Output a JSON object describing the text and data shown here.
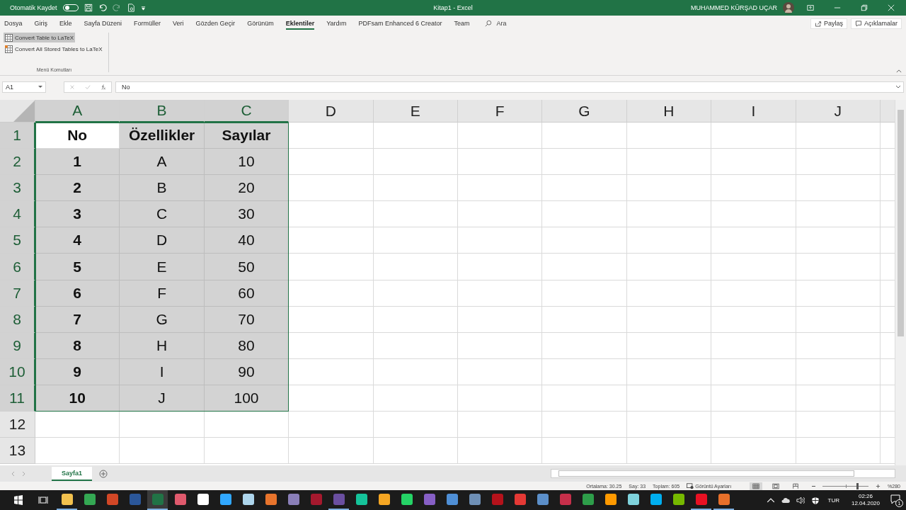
{
  "title_bar": {
    "autosave_label": "Otomatik Kaydet",
    "autosave_on": false,
    "title": "Kitap1 - Excel",
    "user": "MUHAMMED KÜRŞAD UÇAR"
  },
  "tabs": [
    {
      "label": "Dosya",
      "selected": false
    },
    {
      "label": "Giriş",
      "selected": false
    },
    {
      "label": "Ekle",
      "selected": false
    },
    {
      "label": "Sayfa Düzeni",
      "selected": false
    },
    {
      "label": "Formüller",
      "selected": false
    },
    {
      "label": "Veri",
      "selected": false
    },
    {
      "label": "Gözden Geçir",
      "selected": false
    },
    {
      "label": "Görünüm",
      "selected": false
    },
    {
      "label": "Eklentiler",
      "selected": true
    },
    {
      "label": "Yardım",
      "selected": false
    },
    {
      "label": "PDFsam Enhanced 6 Creator",
      "selected": false
    },
    {
      "label": "Team",
      "selected": false
    }
  ],
  "search": {
    "placeholder": "Ara"
  },
  "share_button": "Paylaş",
  "comments_button": "Açıklamalar",
  "ribbon": {
    "group_label": "Menü Komutları",
    "commands": [
      {
        "label": "Convert Table to LaTeX",
        "selected": true
      },
      {
        "label": "Convert All Stored Tables to LaTeX",
        "selected": false
      }
    ]
  },
  "formula_bar": {
    "name_box": "A1",
    "formula": "No"
  },
  "columns": [
    {
      "label": "A",
      "selected": true
    },
    {
      "label": "B",
      "selected": true
    },
    {
      "label": "C",
      "selected": true
    },
    {
      "label": "D",
      "selected": false
    },
    {
      "label": "E",
      "selected": false
    },
    {
      "label": "F",
      "selected": false
    },
    {
      "label": "G",
      "selected": false
    },
    {
      "label": "H",
      "selected": false
    },
    {
      "label": "I",
      "selected": false
    },
    {
      "label": "J",
      "selected": false
    }
  ],
  "rows": [
    {
      "label": "1",
      "selected": true,
      "cells": [
        {
          "text": "No",
          "bold": true,
          "selected": false
        },
        {
          "text": "Özellikler",
          "bold": true,
          "selected": true
        },
        {
          "text": "Sayılar",
          "bold": true,
          "selected": true
        }
      ]
    },
    {
      "label": "2",
      "selected": true,
      "cells": [
        {
          "text": "1",
          "bold": true,
          "selected": true
        },
        {
          "text": "A",
          "bold": false,
          "selected": true
        },
        {
          "text": "10",
          "bold": false,
          "selected": true
        }
      ]
    },
    {
      "label": "3",
      "selected": true,
      "cells": [
        {
          "text": "2",
          "bold": true,
          "selected": true
        },
        {
          "text": "B",
          "bold": false,
          "selected": true
        },
        {
          "text": "20",
          "bold": false,
          "selected": true
        }
      ]
    },
    {
      "label": "4",
      "selected": true,
      "cells": [
        {
          "text": "3",
          "bold": true,
          "selected": true
        },
        {
          "text": "C",
          "bold": false,
          "selected": true
        },
        {
          "text": "30",
          "bold": false,
          "selected": true
        }
      ]
    },
    {
      "label": "5",
      "selected": true,
      "cells": [
        {
          "text": "4",
          "bold": true,
          "selected": true
        },
        {
          "text": "D",
          "bold": false,
          "selected": true
        },
        {
          "text": "40",
          "bold": false,
          "selected": true
        }
      ]
    },
    {
      "label": "6",
      "selected": true,
      "cells": [
        {
          "text": "5",
          "bold": true,
          "selected": true
        },
        {
          "text": "E",
          "bold": false,
          "selected": true
        },
        {
          "text": "50",
          "bold": false,
          "selected": true
        }
      ]
    },
    {
      "label": "7",
      "selected": true,
      "cells": [
        {
          "text": "6",
          "bold": true,
          "selected": true
        },
        {
          "text": "F",
          "bold": false,
          "selected": true
        },
        {
          "text": "60",
          "bold": false,
          "selected": true
        }
      ]
    },
    {
      "label": "8",
      "selected": true,
      "cells": [
        {
          "text": "7",
          "bold": true,
          "selected": true
        },
        {
          "text": "G",
          "bold": false,
          "selected": true
        },
        {
          "text": "70",
          "bold": false,
          "selected": true
        }
      ]
    },
    {
      "label": "9",
      "selected": true,
      "cells": [
        {
          "text": "8",
          "bold": true,
          "selected": true
        },
        {
          "text": "H",
          "bold": false,
          "selected": true
        },
        {
          "text": "80",
          "bold": false,
          "selected": true
        }
      ]
    },
    {
      "label": "10",
      "selected": true,
      "cells": [
        {
          "text": "9",
          "bold": true,
          "selected": true
        },
        {
          "text": "I",
          "bold": false,
          "selected": true
        },
        {
          "text": "90",
          "bold": false,
          "selected": true
        }
      ]
    },
    {
      "label": "11",
      "selected": true,
      "cells": [
        {
          "text": "10",
          "bold": true,
          "selected": true
        },
        {
          "text": "J",
          "bold": false,
          "selected": true
        },
        {
          "text": "100",
          "bold": false,
          "selected": true
        }
      ]
    },
    {
      "label": "12",
      "selected": false,
      "cells": []
    },
    {
      "label": "13",
      "selected": false,
      "cells": []
    }
  ],
  "sheet_tabs": [
    {
      "label": "Sayfa1",
      "selected": true
    }
  ],
  "status_bar": {
    "stats": [
      "Ortalama: 30.25",
      "Say: 33",
      "Toplam: 605"
    ],
    "display_settings": "Görüntü Ayarları",
    "zoom": {
      "level": 0.75,
      "reading": "%280"
    }
  },
  "taskbar": {
    "apps": [
      {
        "color": "#f2c14e",
        "running": true,
        "selected": false
      },
      {
        "color": "#34a853",
        "running": false,
        "selected": false
      },
      {
        "color": "#d24726",
        "running": false,
        "selected": false
      },
      {
        "color": "#2b579a",
        "running": false,
        "selected": false
      },
      {
        "color": "#217346",
        "running": true,
        "selected": true
      },
      {
        "color": "#e05a6d",
        "running": false,
        "selected": false
      },
      {
        "color": "#ffffff",
        "running": false,
        "selected": false
      },
      {
        "color": "#31a8ff",
        "running": false,
        "selected": false
      },
      {
        "color": "#add5ec",
        "running": false,
        "selected": false
      },
      {
        "color": "#e8742c",
        "running": false,
        "selected": false
      },
      {
        "color": "#8a7fb8",
        "running": false,
        "selected": false
      },
      {
        "color": "#a6192e",
        "running": false,
        "selected": false
      },
      {
        "color": "#6a4fa0",
        "running": true,
        "selected": false
      },
      {
        "color": "#15c39a",
        "running": false,
        "selected": false
      },
      {
        "color": "#f5a623",
        "running": false,
        "selected": false
      },
      {
        "color": "#25d366",
        "running": false,
        "selected": false
      },
      {
        "color": "#865fc5",
        "running": false,
        "selected": false
      },
      {
        "color": "#4f8fd6",
        "running": false,
        "selected": false
      },
      {
        "color": "#6e8fb5",
        "running": false,
        "selected": false
      },
      {
        "color": "#b5121b",
        "running": false,
        "selected": false
      },
      {
        "color": "#e53935",
        "running": false,
        "selected": false
      },
      {
        "color": "#5c8fc9",
        "running": false,
        "selected": false
      },
      {
        "color": "#c62f4a",
        "running": false,
        "selected": false
      },
      {
        "color": "#2e9e4a",
        "running": false,
        "selected": false
      },
      {
        "color": "#ff9a00",
        "running": false,
        "selected": false
      },
      {
        "color": "#7fd3dc",
        "running": false,
        "selected": false
      },
      {
        "color": "#00aff0",
        "running": false,
        "selected": false
      },
      {
        "color": "#76b900",
        "running": false,
        "selected": false
      },
      {
        "color": "#e81123",
        "running": true,
        "selected": false
      },
      {
        "color": "#e8702a",
        "running": true,
        "selected": false
      }
    ],
    "language": "TUR",
    "time": "02:26",
    "date": "12.04.2020",
    "notification_count": "1"
  }
}
